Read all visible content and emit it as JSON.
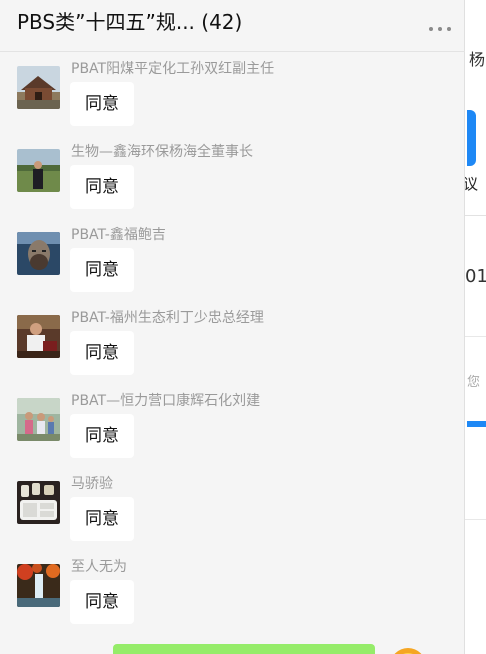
{
  "chat": {
    "title": "PBS类”十四五”规... (42)",
    "messages": [
      {
        "sender": "PBAT阳煤平定化工孙双红副主任",
        "text": "同意",
        "avatar_icon": "building-photo-icon"
      },
      {
        "sender": "生物—鑫海环保杨海全董事长",
        "text": "同意",
        "avatar_icon": "person-outdoor-photo-icon"
      },
      {
        "sender": "PBAT-鑫福鲍吉",
        "text": "同意",
        "avatar_icon": "portrait-photo-icon"
      },
      {
        "sender": "PBAT-福州生态利丁少忠总经理",
        "text": "同意",
        "avatar_icon": "person-seated-photo-icon"
      },
      {
        "sender": "PBAT—恒力营口康辉石化刘建",
        "text": "同意",
        "avatar_icon": "group-photo-icon"
      },
      {
        "sender": "马骄验",
        "text": "同意",
        "avatar_icon": "food-tray-photo-icon"
      },
      {
        "sender": "至人无为",
        "text": "同意",
        "avatar_icon": "waterfall-photo-icon"
      }
    ]
  },
  "background_window": {
    "name_fragment": "杨",
    "label_fragment": "议",
    "number_fragment": "01",
    "hint_fragment": "您"
  },
  "colors": {
    "panel_bg": "#f5f5f5",
    "bubble_bg": "#ffffff",
    "send_green": "#95ec69",
    "accent_blue": "#1e88f5"
  }
}
